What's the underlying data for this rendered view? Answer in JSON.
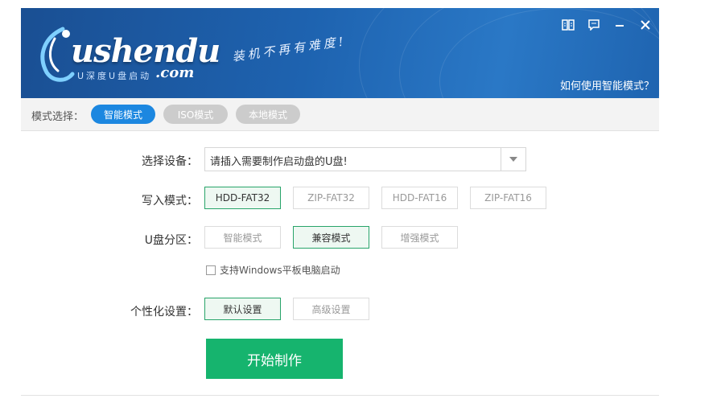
{
  "header": {
    "logo_main": "ushendu",
    "logo_sub": "U深度U盘启动",
    "logo_com": ".com",
    "slogan": "装机不再有难度!",
    "help_link": "如何使用智能模式？",
    "controls": [
      "book-icon",
      "message-icon",
      "minimize-icon",
      "close-icon"
    ]
  },
  "mode_bar": {
    "label": "模式选择：",
    "modes": [
      {
        "label": "智能模式",
        "active": true
      },
      {
        "label": "ISO模式",
        "active": false
      },
      {
        "label": "本地模式",
        "active": false
      }
    ]
  },
  "form": {
    "device_label": "选择设备：",
    "device_value": "请插入需要制作启动盘的U盘!",
    "write_mode_label": "写入模式：",
    "write_modes": [
      "HDD-FAT32",
      "ZIP-FAT32",
      "HDD-FAT16",
      "ZIP-FAT16"
    ],
    "write_mode_selected": "HDD-FAT32",
    "partition_label": "U盘分区：",
    "partitions": [
      "智能模式",
      "兼容模式",
      "增强模式"
    ],
    "partition_selected": "兼容模式",
    "checkbox_label": "支持Windows平板电脑启动",
    "custom_label": "个性化设置：",
    "custom_options": [
      "默认设置",
      "高级设置"
    ],
    "custom_selected": "默认设置",
    "start_button": "开始制作"
  },
  "colors": {
    "header_blue": "#1e63b0",
    "active_pill": "#1c87e0",
    "start_green": "#16b46e",
    "selected_border": "#28a46a"
  }
}
